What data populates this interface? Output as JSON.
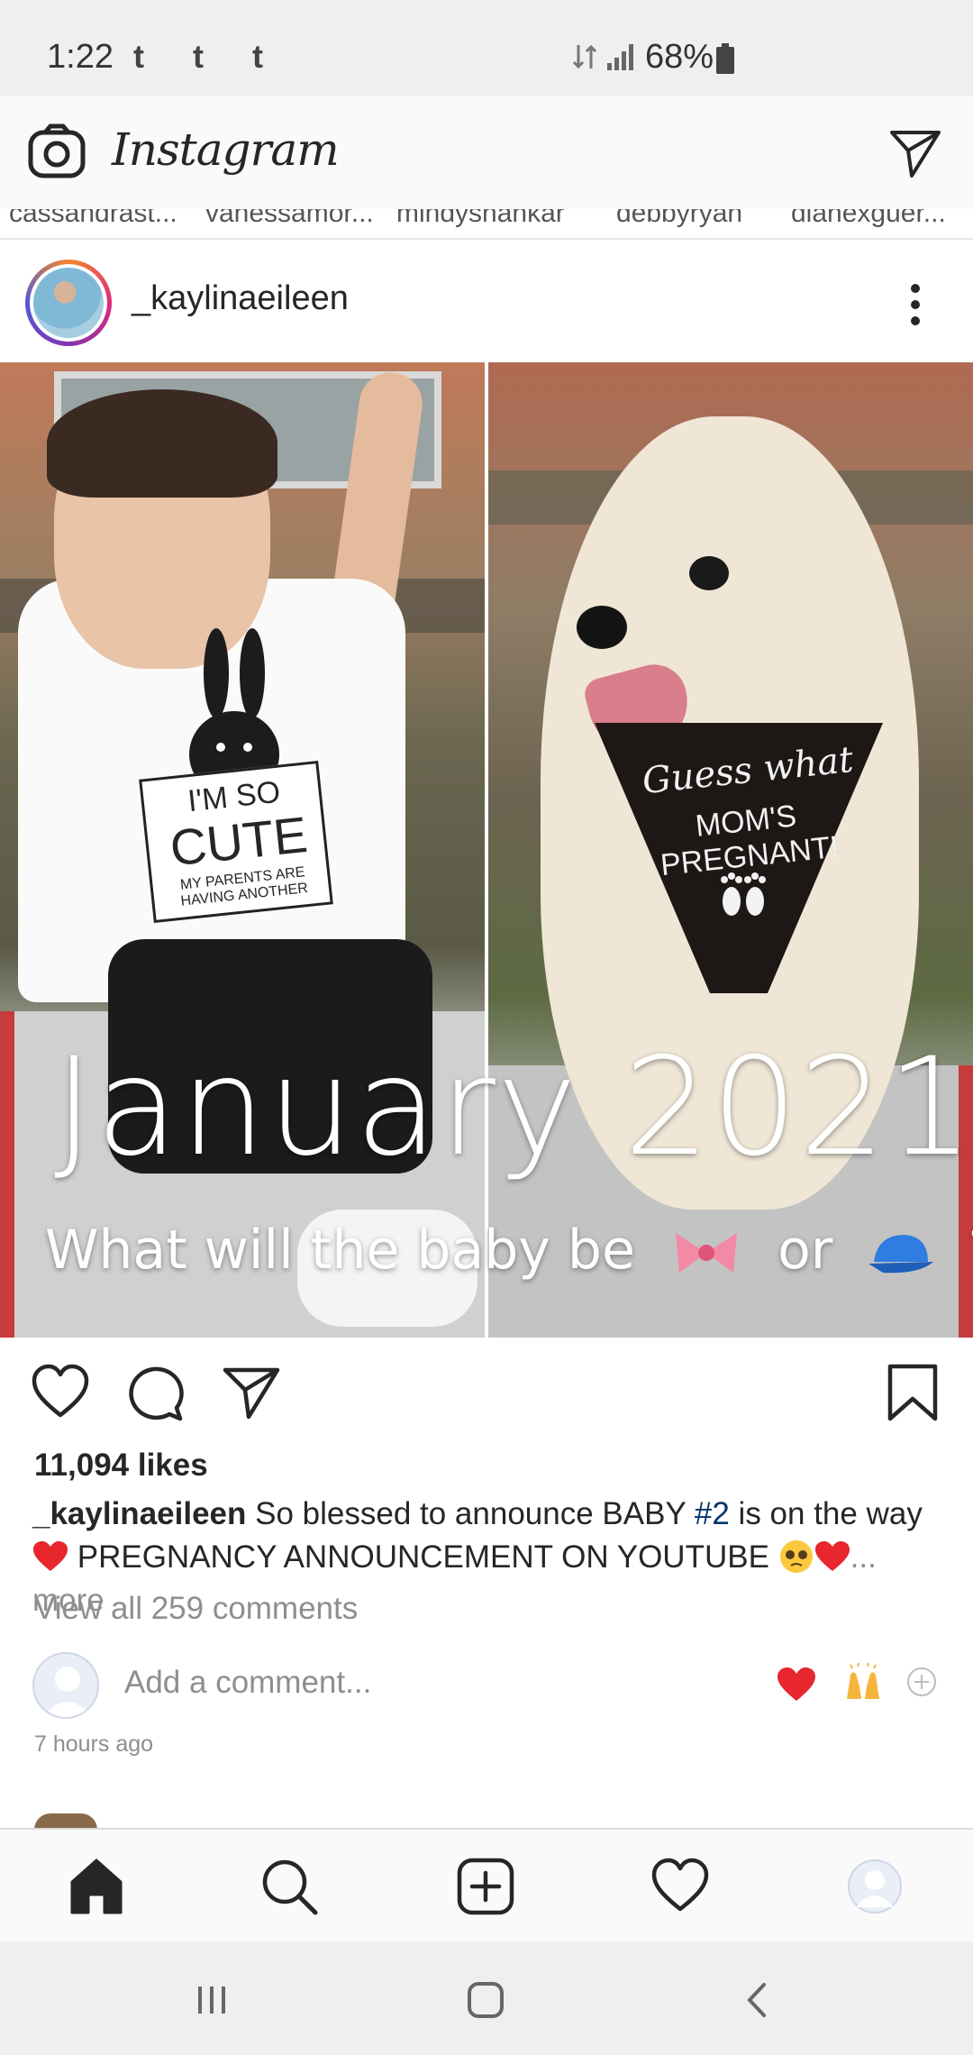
{
  "status_bar": {
    "time": "1:22",
    "notifications": "t t t",
    "battery": "68%"
  },
  "header": {
    "logo_text": "Instagram"
  },
  "stories": [
    "cassandrast...",
    "vanessamor...",
    "mindyshankar",
    "debbyryan",
    "dianexguer..."
  ],
  "post": {
    "username": "_kaylinaeileen",
    "image": {
      "shirt_line1": "I'M SO",
      "shirt_line2": "CUTE",
      "shirt_line3": "MY PARENTS ARE HAVING ANOTHER",
      "bandana_line1": "Guess what",
      "bandana_line2": "MOM'S PREGNANT!",
      "overlay_title": "January 2021",
      "overlay_question_prefix": "What will the baby be",
      "overlay_question_or": "or",
      "overlay_question_end": "?"
    },
    "likes": "11,094 likes",
    "caption": {
      "username": "_kaylinaeileen",
      "text_1": " So blessed to announce BABY ",
      "hashtag": "#2",
      "text_2": " is on the way",
      "text_3": " PREGNANCY ANNOUNCEMENT ON YOUTUBE ",
      "more": "... more"
    },
    "view_comments": "View all 259 comments",
    "add_comment_placeholder": "Add a comment...",
    "timestamp": "7 hours ago"
  },
  "colors": {
    "heart_red": "#e8262d",
    "hashtag_blue": "#003569",
    "muted": "#8e8e8e"
  }
}
